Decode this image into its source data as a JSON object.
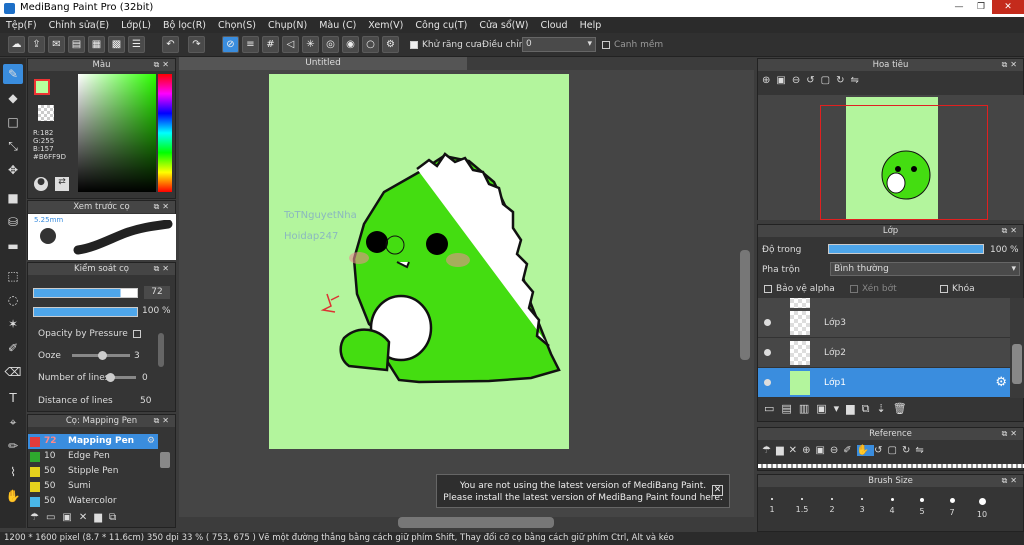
{
  "app": {
    "title": "MediBang Paint Pro (32bit)"
  },
  "menu": [
    "Tệp(F)",
    "Chỉnh sửa(E)",
    "Lớp(L)",
    "Bộ lọc(R)",
    "Chọn(S)",
    "Chụp(N)",
    "Màu (C)",
    "Xem(V)",
    "Công cụ(T)",
    "Cửa sổ(W)",
    "Cloud",
    "Help"
  ],
  "toolbar": {
    "antialias": "Khử răng cưa",
    "correction": "Điều chỉnh",
    "correction_value": "0",
    "snap": "Canh mềm"
  },
  "color_panel": {
    "title": "Màu",
    "r": "R:182",
    "g": "G:255",
    "b": "B:157",
    "hex": "#B6FF9D"
  },
  "preview_panel": {
    "title": "Xem trước cọ",
    "size": "5.25mm"
  },
  "brush_control": {
    "title": "Kiểm soát cọ",
    "size_value": "72",
    "opacity_value": "100 %",
    "opacity_by_pressure": "Opacity by Pressure",
    "ooze": "Ooze",
    "ooze_value": "3",
    "lines": "Number of lines",
    "lines_value": "0",
    "distance": "Distance of lines",
    "distance_value": "50"
  },
  "brush_list": {
    "title": "Cọ: Mapping Pen",
    "items": [
      {
        "size": "72",
        "name": "Mapping Pen",
        "color": "#e23b3b"
      },
      {
        "size": "10",
        "name": "Edge Pen",
        "color": "#2ea82e"
      },
      {
        "size": "50",
        "name": "Stipple Pen",
        "color": "#e6d21d"
      },
      {
        "size": "50",
        "name": "Sumi",
        "color": "#e6d21d"
      },
      {
        "size": "50",
        "name": "Watercolor",
        "color": "#49b7e8"
      }
    ]
  },
  "document": {
    "tab": "Untitled",
    "watermark1": "ToTNguyetNha",
    "watermark2": "Hoidap247"
  },
  "navigator": {
    "title": "Hoa tiêu"
  },
  "layer_panel": {
    "title": "Lớp",
    "opacity_label": "Độ trong",
    "opacity_value": "100 %",
    "blend_label": "Pha trộn",
    "blend_value": "Bình thường",
    "alpha": "Bảo vệ alpha",
    "clip": "Xén bớt",
    "lock": "Khóa",
    "layers": [
      {
        "name": "Lớp3"
      },
      {
        "name": "Lớp2"
      },
      {
        "name": "Lớp1"
      }
    ]
  },
  "reference": {
    "title": "Reference"
  },
  "brush_size": {
    "title": "Brush Size",
    "sizes": [
      "1",
      "1.5",
      "2",
      "3",
      "4",
      "5",
      "7",
      "10"
    ]
  },
  "notice": {
    "line1": "You are not using the latest version of MediBang Paint.",
    "line2": "Please install the latest version of MediBang Paint found here."
  },
  "status": "1200 * 1600 pixel  (8.7 * 11.6cm)  350 dpi  33 %  ( 753, 675 )  Vẽ một đường thẳng bằng cách giữ phím Shift, Thay đổi cỡ cọ bằng cách giữ phím Ctrl, Alt và kéo"
}
